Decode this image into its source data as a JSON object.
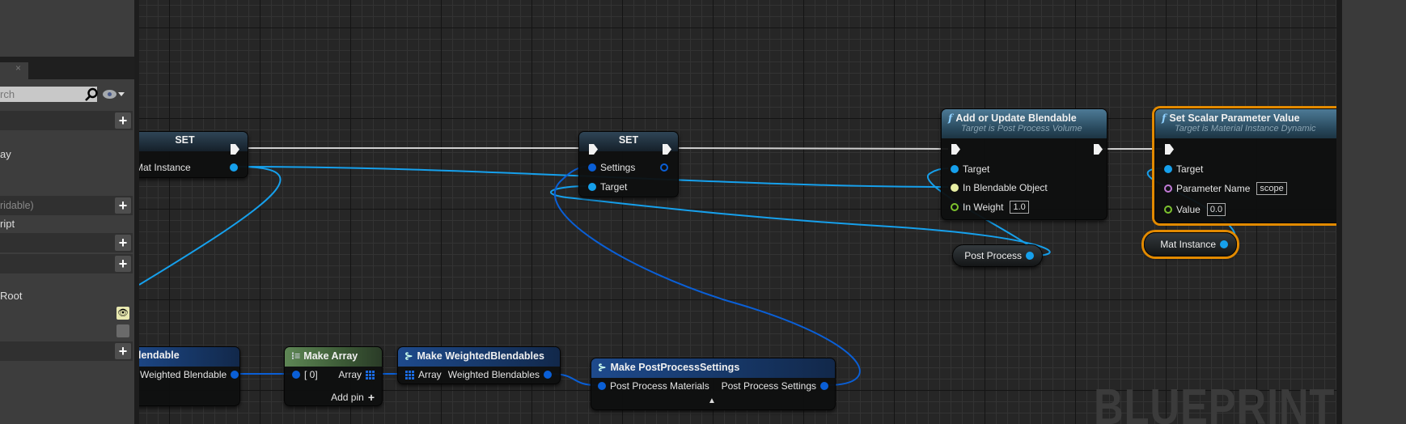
{
  "left_panel": {
    "tab_close": "×",
    "search_placeholder": "rch",
    "items": [
      {
        "kind": "section",
        "label": "",
        "has_add": true
      },
      {
        "kind": "text",
        "label": "ay"
      },
      {
        "kind": "section",
        "label": "ridable)",
        "has_add": true
      },
      {
        "kind": "text",
        "label": "ript"
      },
      {
        "kind": "section",
        "label": "",
        "has_add": true
      },
      {
        "kind": "section",
        "label": "",
        "has_add": true
      },
      {
        "kind": "text",
        "label": "Root"
      },
      {
        "kind": "section",
        "label": "",
        "has_add": true
      }
    ],
    "add_label": "+"
  },
  "graph": {
    "watermark": "BLUEPRINT",
    "nodes": {
      "set1": {
        "title": "SET",
        "pin": "Mat Instance"
      },
      "set2": {
        "title": "SET",
        "pins": [
          "Settings",
          "Target"
        ]
      },
      "add_blendable": {
        "title": "Add or Update Blendable",
        "subtitle": "Target is Post Process Volume",
        "pins": [
          "Target",
          "In Blendable Object",
          "In Weight"
        ],
        "in_weight": "1.0"
      },
      "set_scalar": {
        "title": "Set Scalar Parameter Value",
        "subtitle": "Target is Material Instance Dynamic",
        "pins": [
          "Target",
          "Parameter Name",
          "Value"
        ],
        "parameter_name": "scope",
        "value": "0.0"
      },
      "post_process_var": {
        "label": "Post Process"
      },
      "mat_instance_var": {
        "label": "Mat Instance"
      },
      "make_weighted_blendable": {
        "title": "lendable",
        "pin": "Weighted Blendable"
      },
      "make_array": {
        "title": "Make Array",
        "in_pin": "[ 0]",
        "out_pin": "Array",
        "add_pin": "Add pin"
      },
      "make_weighted_blendables": {
        "title": "Make WeightedBlendables",
        "in_pin": "Array",
        "out_pin": "Weighted Blendables"
      },
      "make_pps": {
        "title": "Make PostProcessSettings",
        "in_pin": "Post Process Materials",
        "out_pin": "Post Process Settings",
        "expand": "▲"
      }
    }
  },
  "colors": {
    "object_pin": "#16a0ec",
    "struct_pin": "#0a5fd6",
    "float_pin": "#7cc22e",
    "name_pin": "#c27ad6",
    "selection": "#e28a00",
    "exec_wire": "#cfcfcf"
  }
}
